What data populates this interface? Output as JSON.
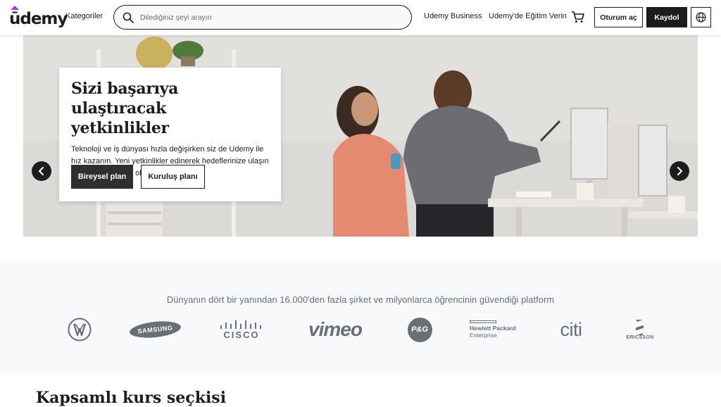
{
  "header": {
    "logo_text": "ūdemy",
    "categories_label": "Kategoriler",
    "search_placeholder": "Dilediğiniz şeyi arayın",
    "business_link": "Udemy Business",
    "teach_link": "Udemy'de Eğitim Verin",
    "login_label": "Oturum aç",
    "signup_label": "Kaydol",
    "icons": [
      "search-icon",
      "cart-icon",
      "globe-icon"
    ]
  },
  "hero": {
    "title": "Sizi başarıya ulaştıracak yetkinlikler",
    "description": "Teknoloji ve iş dünyası hızla değişirken siz de Udemy ile hız kazanın. Yeni yetkinlikler edinerek hedeflerinize ulaşın ve rekabette önde olun.",
    "primary_button": "Bireysel plan",
    "secondary_button": "Kuruluş planı",
    "prev_icon": "chevron-left-icon",
    "next_icon": "chevron-right-icon"
  },
  "trusted": {
    "text": "Dünyanın dört bir yanından 16.000'den fazla şirket ve milyonlarca öğrencinin güvendiği platform",
    "companies": {
      "samsung": "SAMSUNG",
      "cisco": "CISCO",
      "vimeo": "vimeo",
      "pg": "P&G",
      "hpe_line1": "Hewlett Packard",
      "hpe_line2": "Enterprise",
      "citi": "citi",
      "ericsson": "ERICSSON"
    },
    "company_logos": [
      "volkswagen-logo",
      "samsung-logo",
      "cisco-logo",
      "vimeo-logo",
      "pg-logo",
      "hewlett-packard-enterprise-logo",
      "citi-logo",
      "ericsson-logo"
    ]
  },
  "courses": {
    "title": "Kapsamlı kurs seçkisi"
  },
  "colors": {
    "text_dark": "#1c1d1f",
    "band_bg": "#f7f9fa",
    "muted": "#6a6f73",
    "accent_purple": "#a435f0"
  }
}
